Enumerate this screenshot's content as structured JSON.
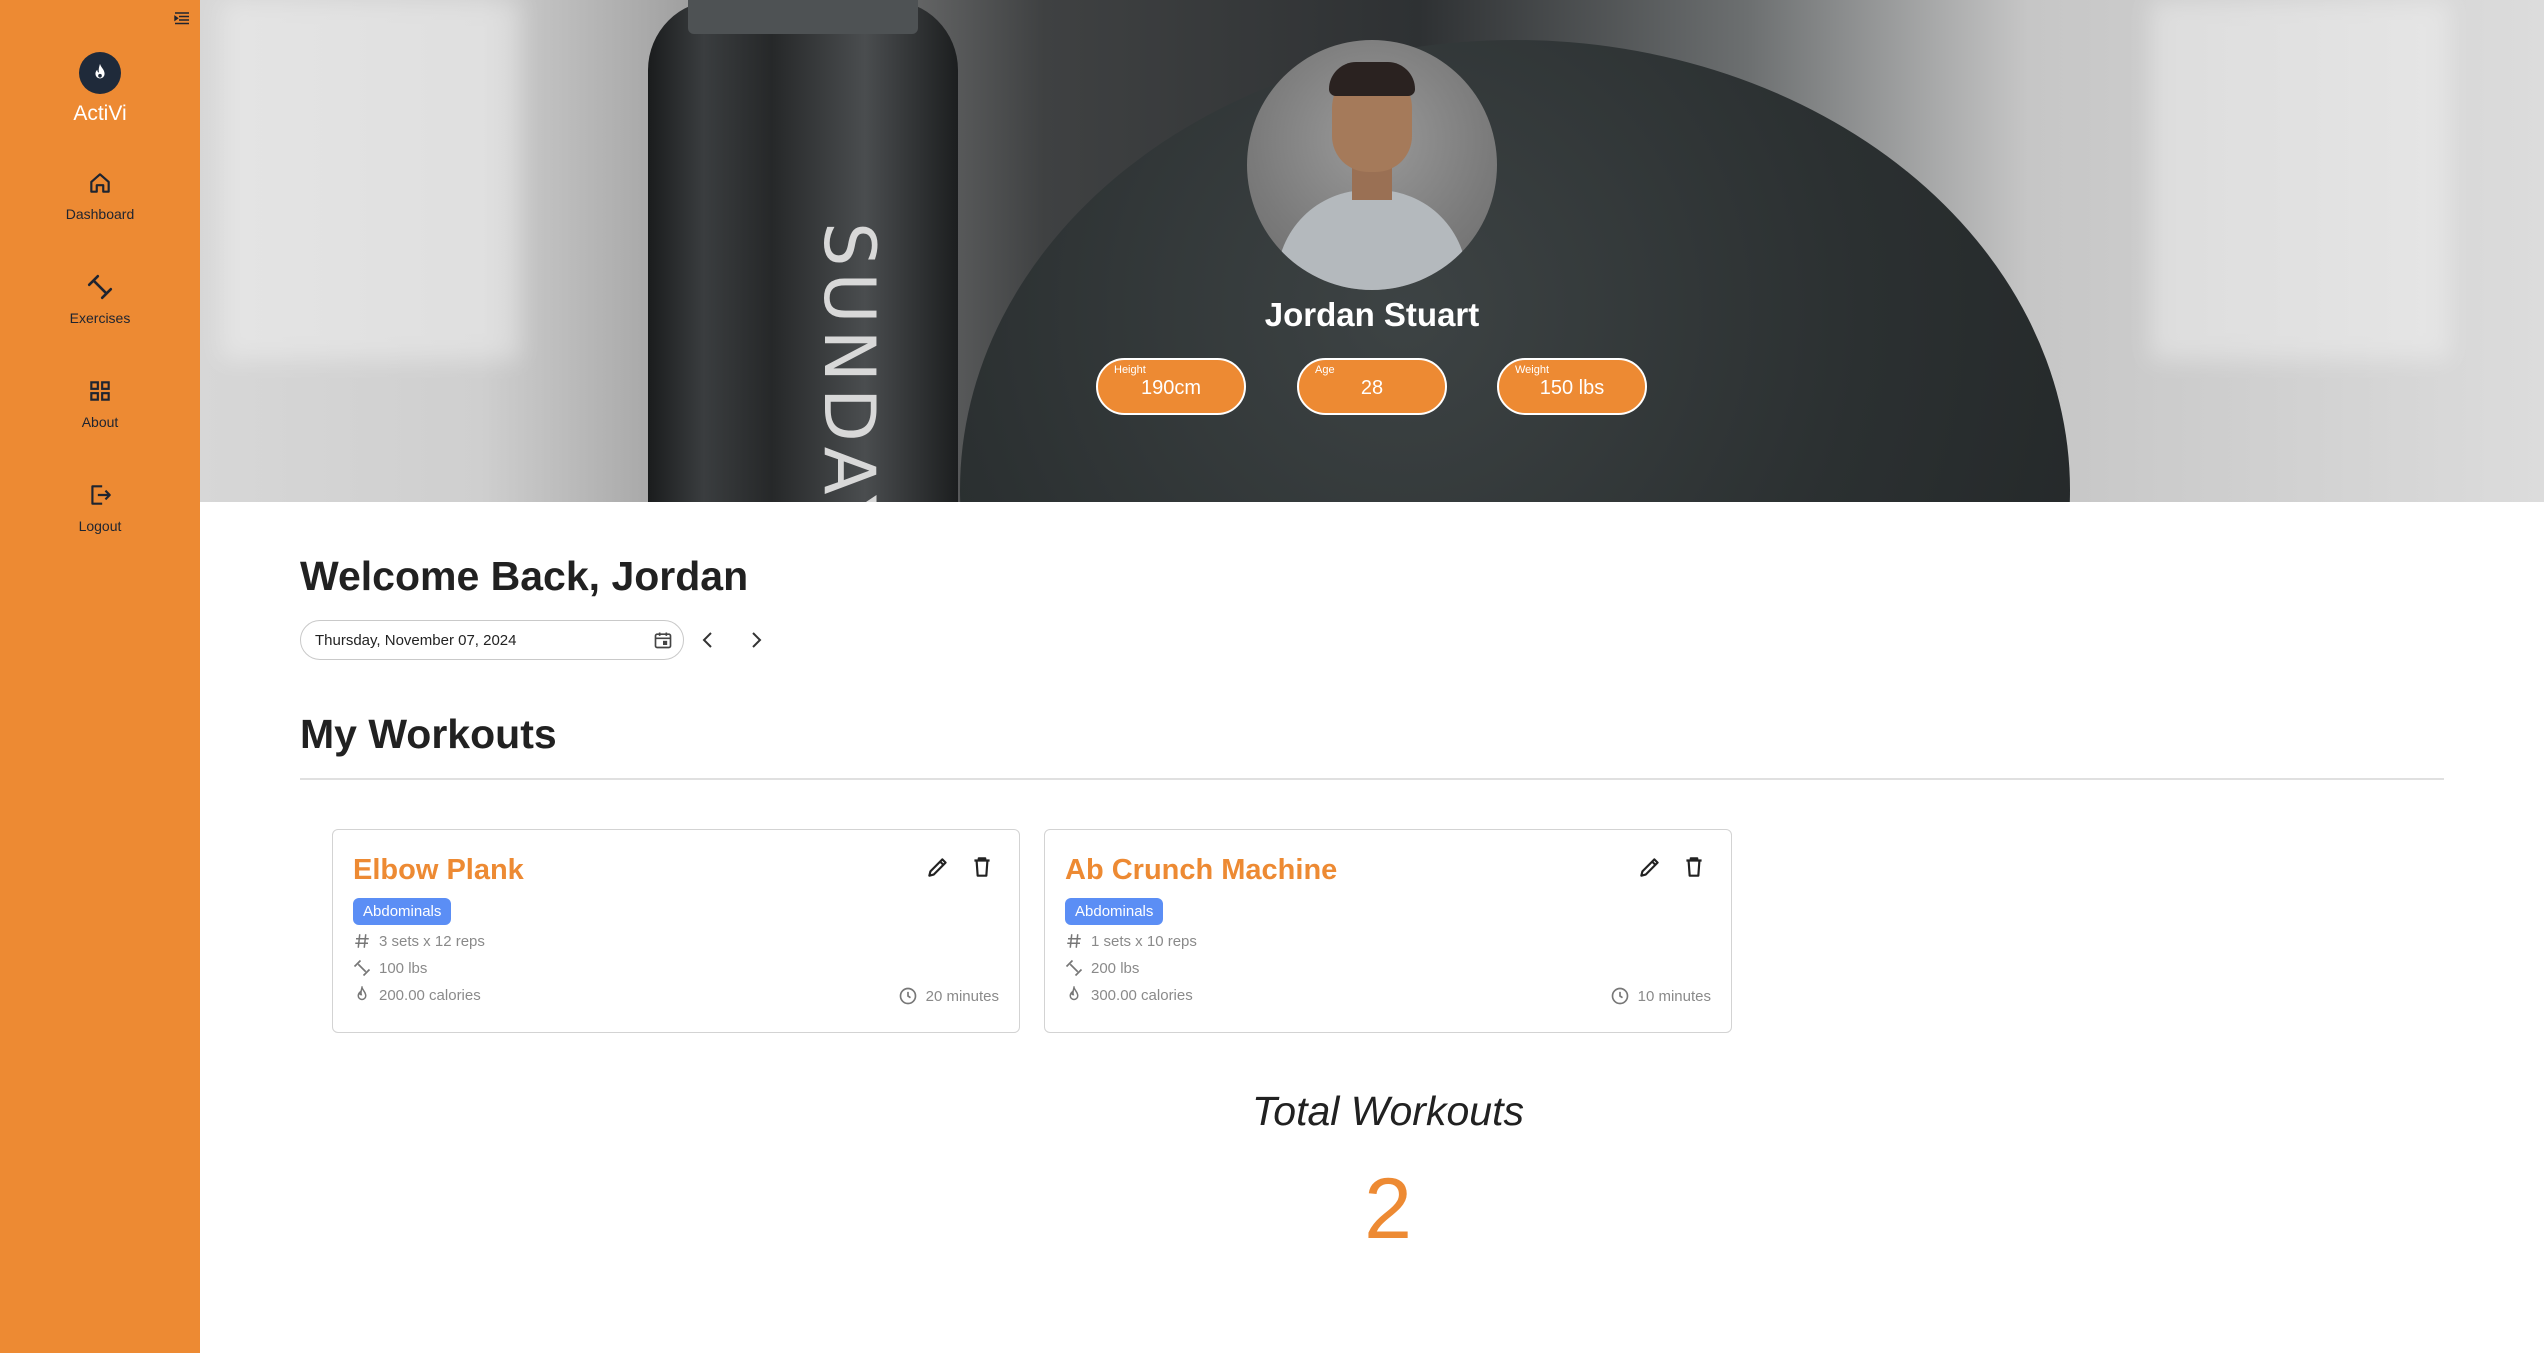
{
  "app": {
    "name": "ActiVi"
  },
  "sidebar": {
    "items": [
      {
        "label": "Dashboard",
        "icon": "home-icon"
      },
      {
        "label": "Exercises",
        "icon": "dumbbell-icon"
      },
      {
        "label": "About",
        "icon": "grid-icon"
      },
      {
        "label": "Logout",
        "icon": "logout-icon"
      }
    ]
  },
  "hero": {
    "bottle_text": "SUNDAY"
  },
  "profile": {
    "name": "Jordan Stuart",
    "stats": [
      {
        "label": "Height",
        "value": "190cm"
      },
      {
        "label": "Age",
        "value": "28"
      },
      {
        "label": "Weight",
        "value": "150 lbs"
      }
    ]
  },
  "main": {
    "welcome": "Welcome Back, Jordan",
    "date": "Thursday, November 07, 2024",
    "workouts_title": "My Workouts",
    "workouts": [
      {
        "name": "Elbow Plank",
        "category": "Abdominals",
        "sets_reps": "3 sets x 12 reps",
        "weight": "100 lbs",
        "calories": "200.00 calories",
        "duration": "20 minutes"
      },
      {
        "name": "Ab Crunch Machine",
        "category": "Abdominals",
        "sets_reps": "1 sets x 10 reps",
        "weight": "200 lbs",
        "calories": "300.00 calories",
        "duration": "10 minutes"
      }
    ],
    "total_label": "Total Workouts",
    "total_value": "2"
  },
  "colors": {
    "accent": "#ed8a33",
    "badge": "#5b8ef5",
    "text_dark": "#212121"
  }
}
